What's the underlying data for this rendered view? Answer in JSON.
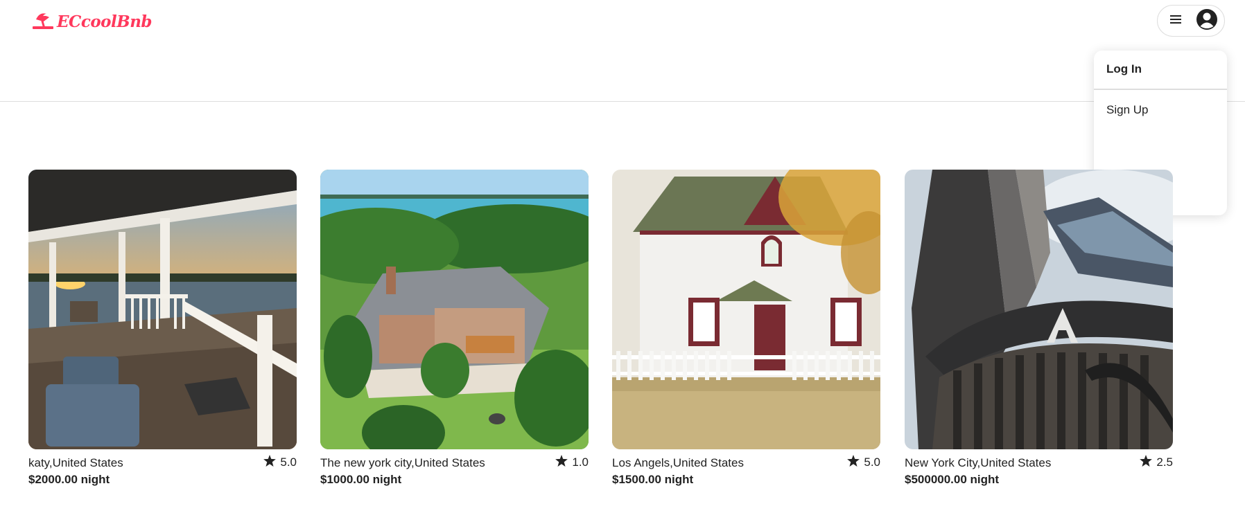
{
  "header": {
    "logo_text": "ECcoolBnb",
    "brand_color": "#ff385c",
    "menu_icon": "hamburger-icon",
    "avatar_icon": "user-avatar-icon"
  },
  "dropdown": {
    "login_label": "Log In",
    "signup_label": "Sign Up"
  },
  "listings": [
    {
      "location": "katy,United States",
      "price": "$2000.00 night",
      "rating": "5.0",
      "image": "porch-sunset"
    },
    {
      "location": "The new york city,United States",
      "price": "$1000.00 night",
      "rating": "1.0",
      "image": "lake-mansion"
    },
    {
      "location": "Los Angels,United States",
      "price": "$1500.00 night",
      "rating": "5.0",
      "image": "white-cottage"
    },
    {
      "location": "New York City,United States",
      "price": "$500000.00 night",
      "rating": "2.5",
      "image": "steel-sculpture"
    }
  ]
}
